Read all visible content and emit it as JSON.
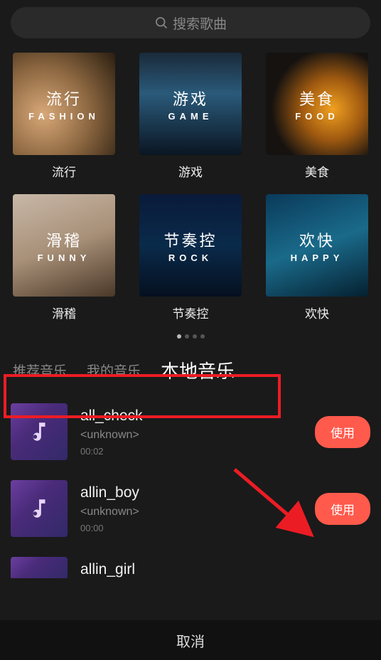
{
  "search": {
    "placeholder": "搜索歌曲"
  },
  "categories": [
    {
      "ch": "流行",
      "en": "FASHION",
      "label": "流行"
    },
    {
      "ch": "游戏",
      "en": "GAME",
      "label": "游戏"
    },
    {
      "ch": "美食",
      "en": "FOOD",
      "label": "美食"
    },
    {
      "ch": "滑稽",
      "en": "FUNNY",
      "label": "滑稽"
    },
    {
      "ch": "节奏控",
      "en": "ROCK",
      "label": "节奏控"
    },
    {
      "ch": "欢快",
      "en": "HAPPY",
      "label": "欢快"
    }
  ],
  "tabs": [
    {
      "label": "推荐音乐",
      "active": false
    },
    {
      "label": "我的音乐",
      "active": false
    },
    {
      "label": "本地音乐",
      "active": true
    }
  ],
  "songs": [
    {
      "title": "all_check",
      "artist": "<unknown>",
      "duration": "00:02",
      "use": "使用"
    },
    {
      "title": "allin_boy",
      "artist": "<unknown>",
      "duration": "00:00",
      "use": "使用"
    },
    {
      "title": "allin_girl"
    }
  ],
  "footer": {
    "cancel": "取消"
  }
}
